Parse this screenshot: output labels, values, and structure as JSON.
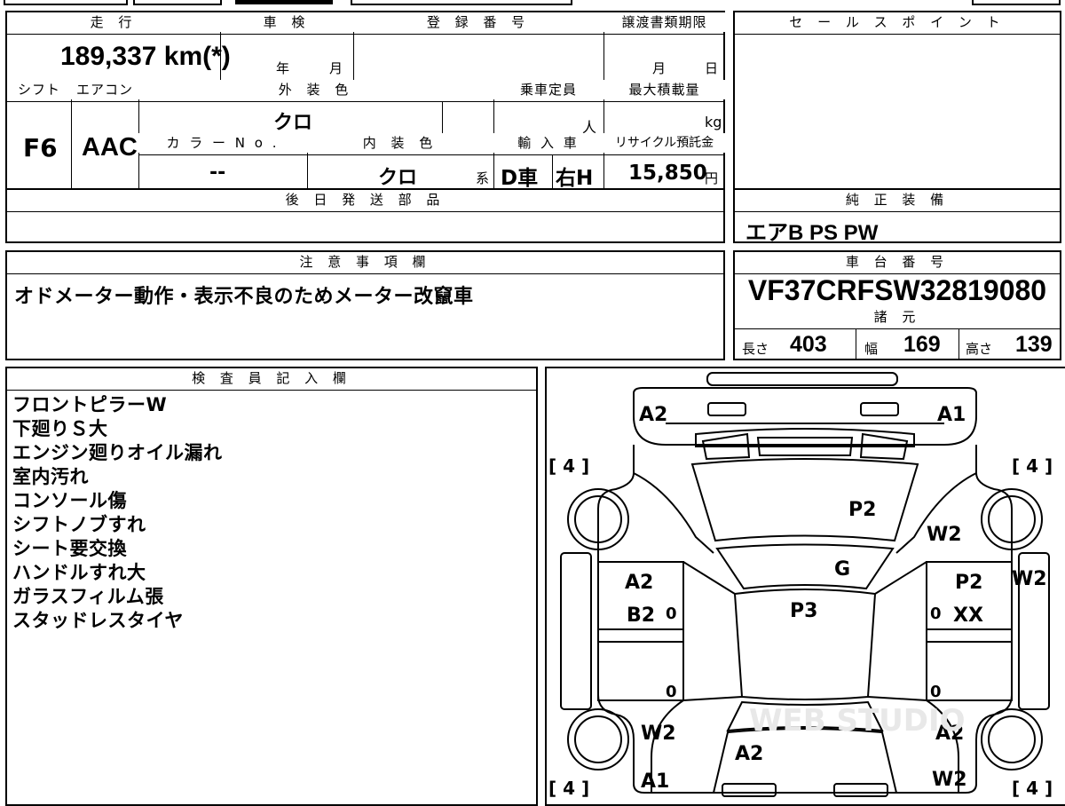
{
  "main": {
    "headers": {
      "mileage": "走 行",
      "inspection": "車 検",
      "registration": "登 録 番 号",
      "transfer_deadline": "譲渡書類期限",
      "shift": "シフト",
      "aircon": "エアコン",
      "exterior_color": "外 装 色",
      "capacity": "乗車定員",
      "max_load": "最大積載量",
      "color_no": "カ ラ ー N o .",
      "interior_color": "内 装 色",
      "import": "輸 入 車",
      "recycle": "リサイクル預託金",
      "later_parts": "後 日 発 送 部 品",
      "notes": "注 意 事 項 欄",
      "inspector": "検 査 員 記 入 欄"
    },
    "values": {
      "mileage": "189,337 km(*)",
      "year_unit": "年",
      "month_unit": "月",
      "deadline_month": "月",
      "deadline_day": "日",
      "shift": "F6",
      "aircon": "AAC",
      "exterior_color": "クロ",
      "capacity_unit": "人",
      "load_unit": "kg",
      "color_no": "--",
      "interior_color": "クロ",
      "interior_suffix": "系",
      "import_type": "D車",
      "handle": "右H",
      "recycle_amount": "15,850",
      "recycle_unit": "円",
      "note_text": "オドメーター動作・表示不良のためメーター改竄車"
    },
    "inspector_notes": [
      "フロントピラーW",
      "下廻りＳ大",
      "エンジン廻りオイル漏れ",
      "室内汚れ",
      "コンソール傷",
      "シフトノブすれ",
      "シート要交換",
      "ハンドルすれ大",
      "ガラスフィルム張",
      "スタッドレスタイヤ"
    ]
  },
  "side": {
    "headers": {
      "sales_point": "セ ー ル ス ポ イ ン ト",
      "genuine_equipment": "純 正 装 備",
      "chassis_number": "車 台 番 号",
      "specs": "諸 元"
    },
    "equipment": "エアB PS PW",
    "chassis_number": "VF37CRFSW32819080",
    "specs": {
      "length_label": "長さ",
      "length": "403",
      "width_label": "幅",
      "width": "169",
      "height_label": "高さ",
      "height": "139"
    }
  },
  "diagram": {
    "labels": {
      "front_left_corner": "A2",
      "front_right_corner": "A1",
      "hood": "P2",
      "front_right_fender": "W2",
      "windshield": "G",
      "roof": "P3",
      "left_front_door_1": "A2",
      "left_front_door_2": "B2",
      "right_front_door_1": "P2",
      "right_front_door_2": "XX",
      "right_edge": "W2",
      "left_rear_fender": "W2",
      "trunk": "A2",
      "right_rear_fender_1": "A2",
      "rear_left_corner": "A1",
      "right_rear_fender_2": "W2",
      "front_left_tire": "[ 4 ]",
      "front_right_tire": "[ 4 ]",
      "rear_left_tire": "[ 4 ]",
      "rear_right_tire": "[ 4 ]",
      "zero_left_1": "0",
      "zero_right_1": "0",
      "zero_left_2": "0",
      "zero_right_2": "0"
    },
    "watermark": "WEB STUDIO"
  }
}
